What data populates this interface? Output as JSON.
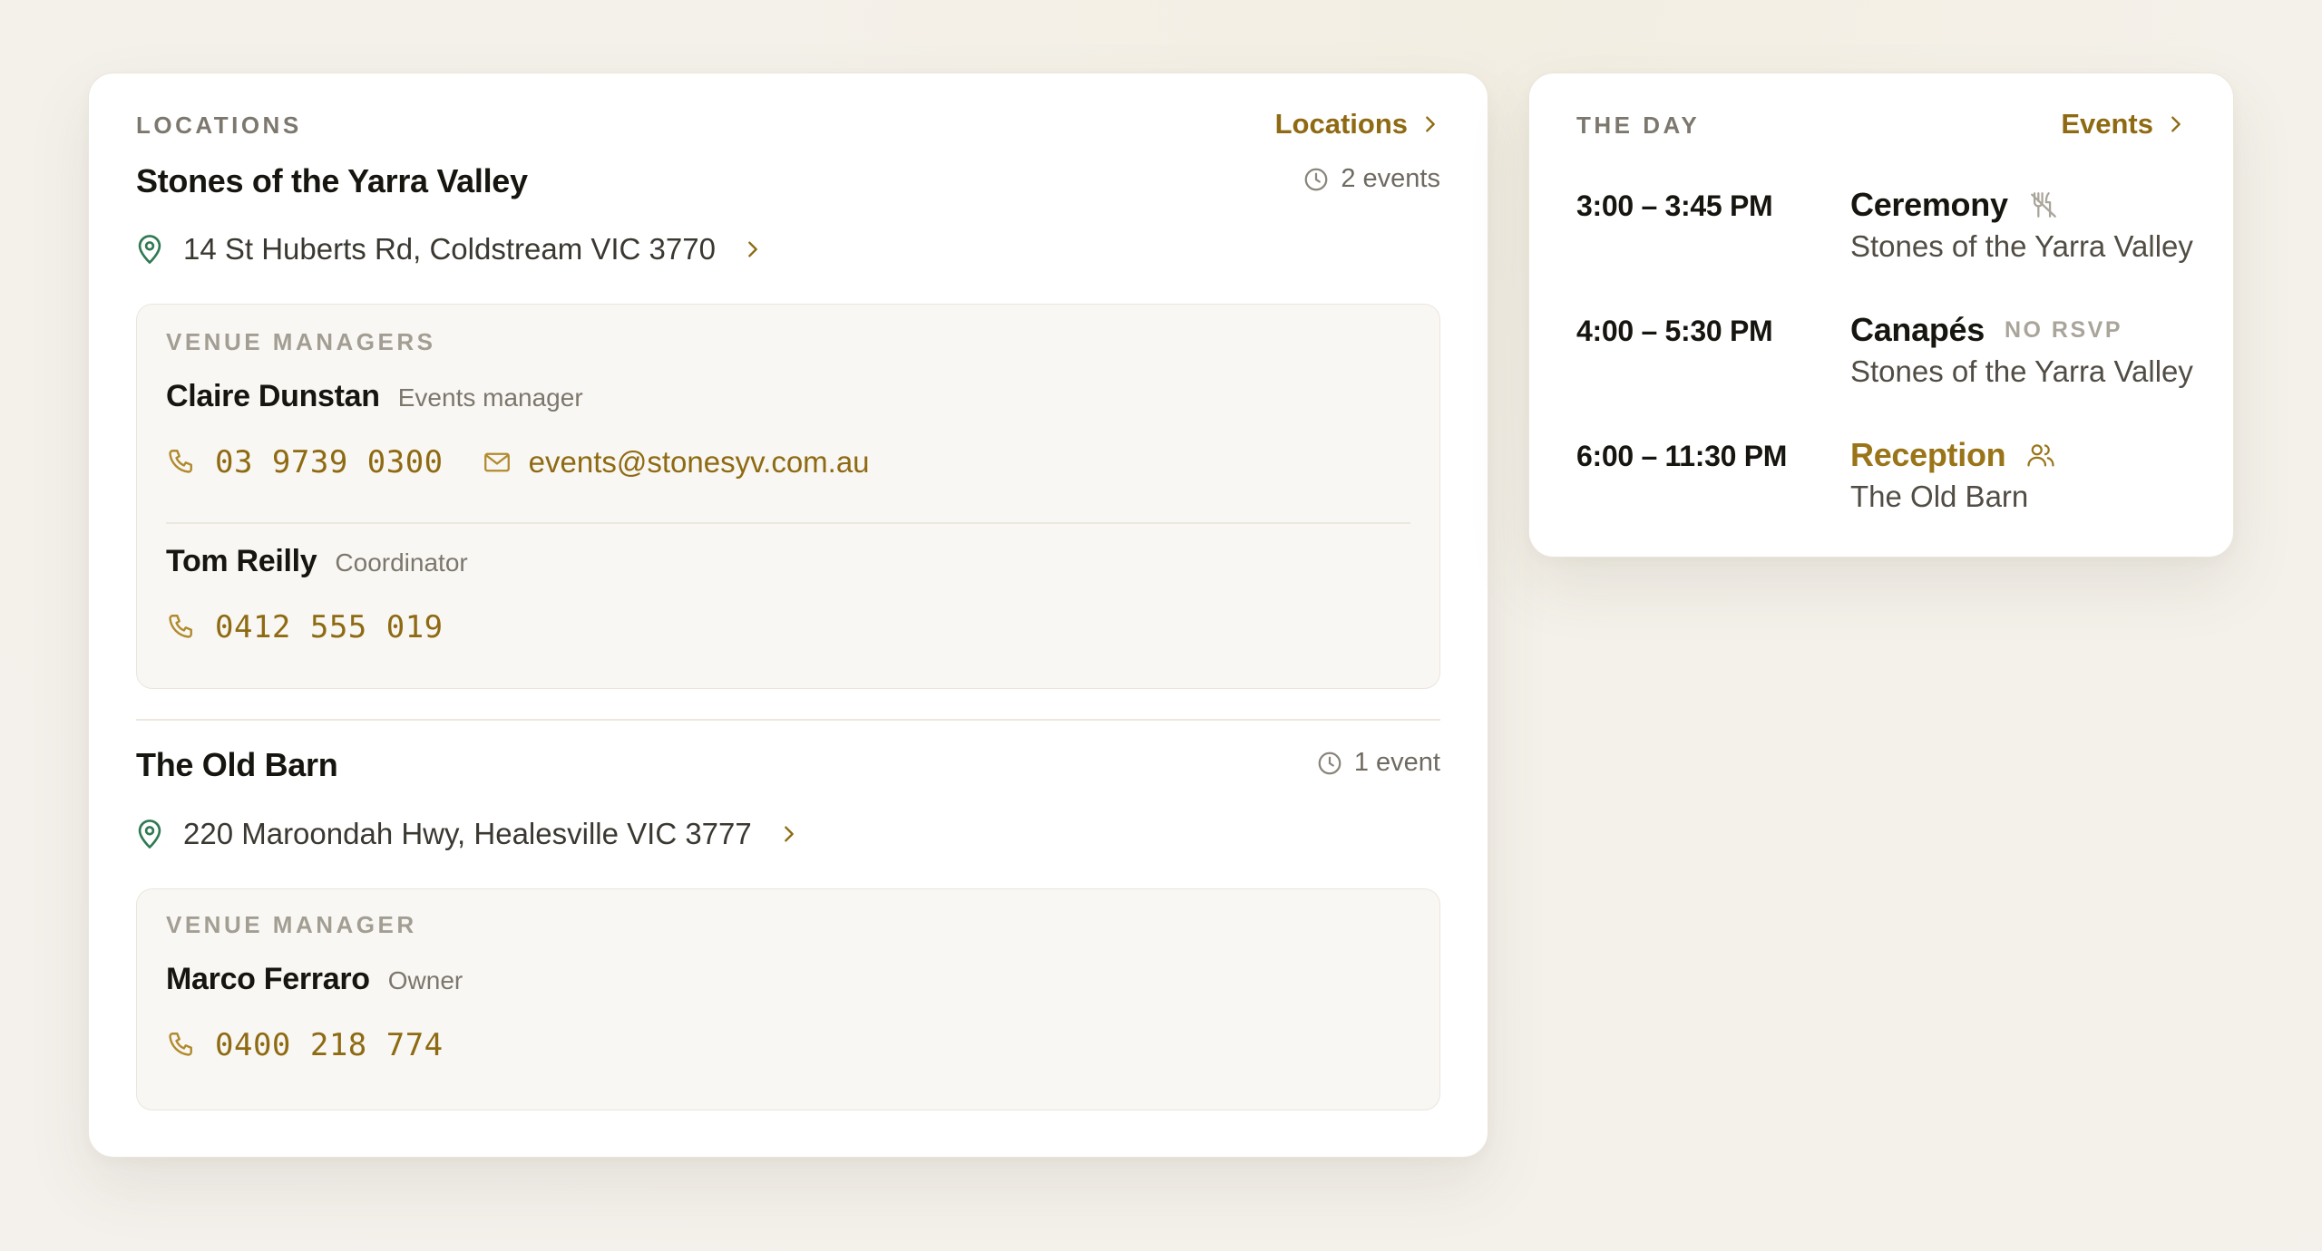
{
  "locations": {
    "section_label": "LOCATIONS",
    "link_label": "Locations",
    "venues": [
      {
        "name": "Stones of the Yarra Valley",
        "events_count": "2 events",
        "address": "14 St Huberts Rd, Coldstream VIC 3770",
        "managers_label": "VENUE MANAGERS",
        "managers": [
          {
            "name": "Claire Dunstan",
            "role": "Events manager",
            "phone": "03 9739 0300",
            "email": "events@stonesyv.com.au"
          },
          {
            "name": "Tom Reilly",
            "role": "Coordinator",
            "phone": "0412 555 019"
          }
        ]
      },
      {
        "name": "The Old Barn",
        "events_count": "1 event",
        "address": "220 Maroondah Hwy, Healesville VIC 3777",
        "managers_label": "VENUE MANAGER",
        "managers": [
          {
            "name": "Marco Ferraro",
            "role": "Owner",
            "phone": "0400 218 774"
          }
        ]
      }
    ]
  },
  "day": {
    "section_label": "THE DAY",
    "link_label": "Events",
    "events": [
      {
        "time": "3:00 – 3:45 PM",
        "title": "Ceremony",
        "venue": "Stones of the Yarra Valley",
        "icon": "no-food-icon"
      },
      {
        "time": "4:00 – 5:30 PM",
        "title": "Canapés",
        "badge": "NO RSVP",
        "venue": "Stones of the Yarra Valley"
      },
      {
        "time": "6:00 – 11:30 PM",
        "title": "Reception",
        "venue": "The Old Barn",
        "icon": "guests-icon"
      }
    ]
  },
  "colors": {
    "accent": "#8e6a12",
    "pin": "#2f7a52",
    "muted": "#7d786e"
  }
}
